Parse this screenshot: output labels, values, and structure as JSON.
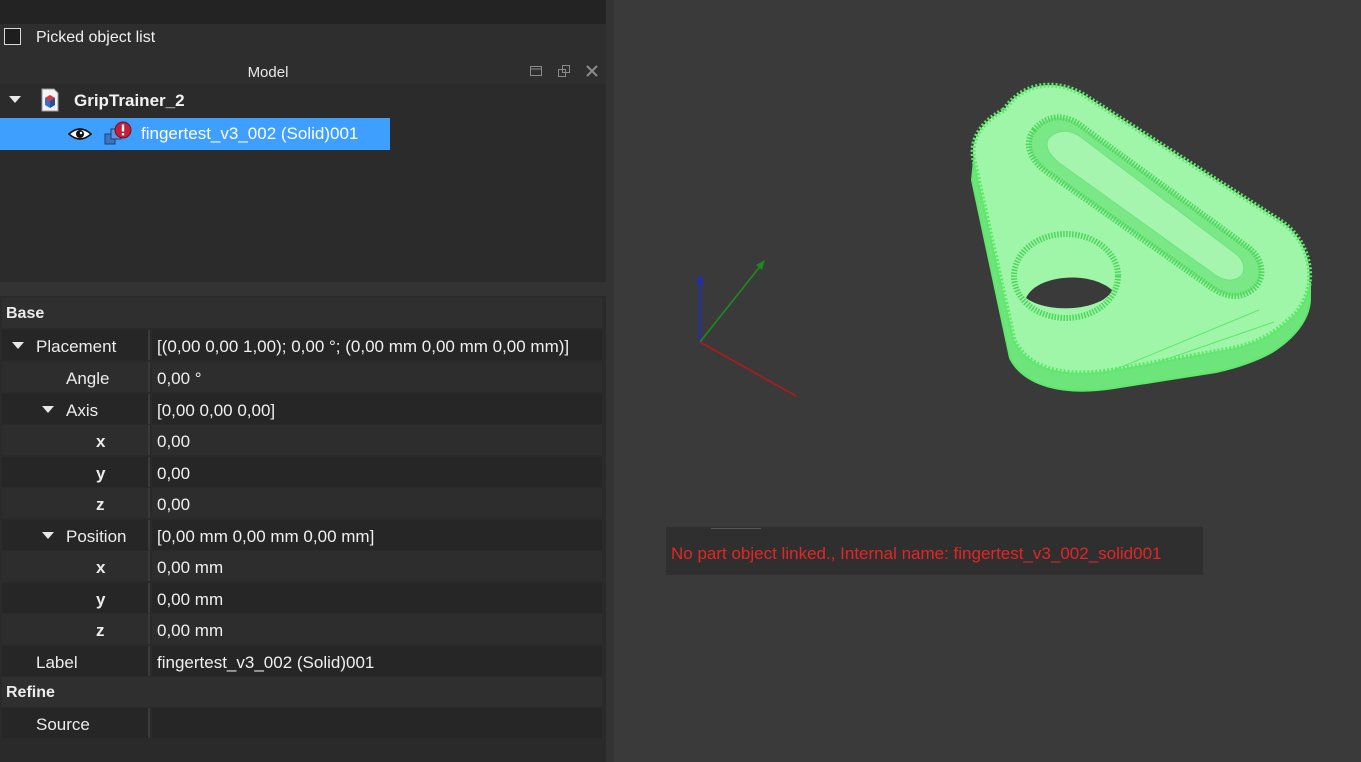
{
  "picked_object_list": {
    "label": "Picked object list",
    "checked": false
  },
  "model_panel": {
    "title": "Model"
  },
  "tree": {
    "document": {
      "label": "GripTrainer_2"
    },
    "object": {
      "label": "fingertest_v3_002 (Solid)001",
      "selected": true
    }
  },
  "properties": {
    "groups": [
      {
        "name": "Base"
      },
      {
        "name": "Refine"
      }
    ],
    "rows": {
      "placement": {
        "name": "Placement",
        "value": "[(0,00 0,00 1,00); 0,00 °; (0,00 mm  0,00 mm  0,00 mm)]"
      },
      "angle": {
        "name": "Angle",
        "value": "0,00 °"
      },
      "axis": {
        "name": "Axis",
        "value": "[0,00 0,00 0,00]"
      },
      "axis_x": {
        "name": "x",
        "value": "0,00"
      },
      "axis_y": {
        "name": "y",
        "value": "0,00"
      },
      "axis_z": {
        "name": "z",
        "value": "0,00"
      },
      "position": {
        "name": "Position",
        "value": "[0,00 mm  0,00 mm  0,00 mm]"
      },
      "pos_x": {
        "name": "x",
        "value": "0,00 mm"
      },
      "pos_y": {
        "name": "y",
        "value": "0,00 mm"
      },
      "pos_z": {
        "name": "z",
        "value": "0,00 mm"
      },
      "label": {
        "name": "Label",
        "value": "fingertest_v3_002 (Solid)001"
      },
      "source": {
        "name": "Source",
        "value": ""
      }
    }
  },
  "view": {
    "message": "No part object linked., Internal name: fingertest_v3_002_solid001",
    "colors": {
      "model_fill": "#9ff5a8",
      "model_edge": "#5ee86b",
      "axis_x": "#b01a1a",
      "axis_y": "#1d8a1d",
      "axis_z": "#1f2fb0",
      "message": "#e52525",
      "selection": "#3f9fff"
    }
  }
}
